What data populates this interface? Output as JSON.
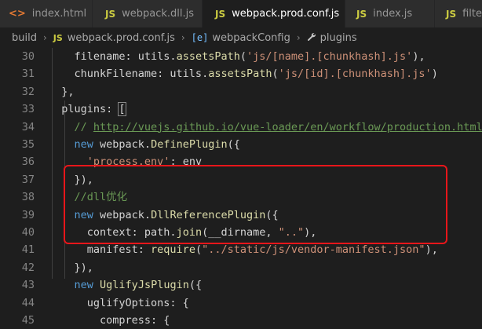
{
  "tabs": [
    {
      "icon": "<>",
      "label": "index.html",
      "icon_name": "html-icon"
    },
    {
      "icon": "JS",
      "label": "webpack.dll.js",
      "icon_name": "js-icon"
    },
    {
      "icon": "JS",
      "label": "webpack.prod.conf.js",
      "icon_name": "js-icon",
      "active": true
    },
    {
      "icon": "JS",
      "label": "index.js",
      "icon_name": "js-icon"
    },
    {
      "icon": "JS",
      "label": "filte",
      "icon_name": "js-icon"
    }
  ],
  "breadcrumb": {
    "folder": "build",
    "file_icon": "JS",
    "file": "webpack.prod.conf.js",
    "symbol_icon": "[e]",
    "symbol": "webpackConfig",
    "property_icon": "wrench",
    "property": "plugins",
    "separator": "›"
  },
  "editor": {
    "lines": [
      {
        "num": "30",
        "code": "    filename: utils.assetsPath('js/[name].[chunkhash].js'),"
      },
      {
        "num": "31",
        "code": "    chunkFilename: utils.assetsPath('js/[id].[chunkhash].js')"
      },
      {
        "num": "32",
        "code": "  },"
      },
      {
        "num": "33",
        "code": "  plugins: ["
      },
      {
        "num": "34",
        "code": "    // http://vuejs.github.io/vue-loader/en/workflow/production.html"
      },
      {
        "num": "35",
        "code": "    new webpack.DefinePlugin({"
      },
      {
        "num": "36",
        "code": "      'process.env': env"
      },
      {
        "num": "37",
        "code": "    }),"
      },
      {
        "num": "38",
        "code": "    //dll优化"
      },
      {
        "num": "39",
        "code": "    new webpack.DllReferencePlugin({"
      },
      {
        "num": "40",
        "code": "      context: path.join(__dirname, \"..\"),"
      },
      {
        "num": "41",
        "code": "      manifest: require(\"../static/js/vendor-manifest.json\"),"
      },
      {
        "num": "42",
        "code": "    }),"
      },
      {
        "num": "43",
        "code": "    new UglifyJsPlugin({"
      },
      {
        "num": "44",
        "code": "      uglifyOptions: {"
      },
      {
        "num": "45",
        "code": "        compress: {"
      }
    ]
  },
  "colors": {
    "keyword": "#569cd6",
    "function": "#dcdcaa",
    "string": "#ce9178",
    "comment": "#6a9955",
    "highlight_box": "#e8161a"
  }
}
